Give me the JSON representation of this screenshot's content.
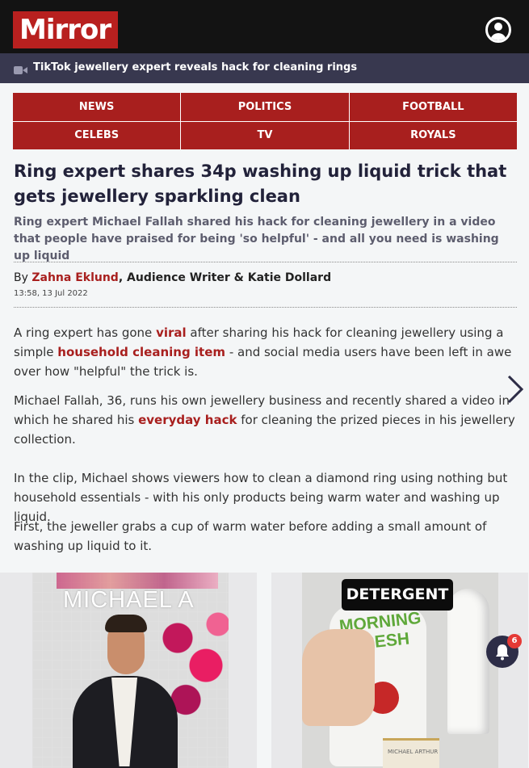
{
  "header": {
    "logo_text": "Mirror",
    "account_icon": "account-icon"
  },
  "video_bar": {
    "icon": "video-camera-icon",
    "title": "TikTok jewellery expert reveals hack for cleaning rings"
  },
  "nav": {
    "items": [
      {
        "label": "NEWS"
      },
      {
        "label": "POLITICS"
      },
      {
        "label": "FOOTBALL"
      },
      {
        "label": "CELEBS"
      },
      {
        "label": "TV"
      },
      {
        "label": "ROYALS"
      }
    ]
  },
  "article": {
    "headline": "Ring expert shares 34p washing up liquid trick that gets jewellery sparkling clean",
    "standfirst": "Ring expert Michael Fallah shared his hack for cleaning jewellery in a video that people have praised for being 'so helpful' - and all you need is washing up liquid",
    "byline": {
      "by": "By",
      "author1": "Zahna Eklund",
      "role": ", Audience Writer & ",
      "author2": " Katie Dollard",
      "timestamp": "13:58, 13 Jul 2022"
    },
    "paragraphs": [
      {
        "t1": "A ring expert has gone ",
        "l1": "viral",
        "t2": " after sharing his hack for cleaning jewellery using a simple ",
        "l2": "household cleaning item",
        "t3": " - and social media users have been left in awe over how \"helpful\" the trick is."
      },
      {
        "t1": "Michael Fallah, 36, runs his own jewellery business and recently shared a video in which he shared his ",
        "l1": "everyday hack",
        "t2": " for cleaning the prized pieces in his jewellery collection."
      },
      {
        "t1": "In the clip, Michael shows viewers how to clean a diamond ring using nothing but household essentials - with his only products being warm water and washing up liquid."
      },
      {
        "t1": "First, the jeweller grabs a cup of warm water before adding a small amount of washing up liquid to it."
      }
    ]
  },
  "images": {
    "photo1_wall_text": "MICHAEL A",
    "photo2_tag": "DETERGENT",
    "photo2_brand_line1": "MORNING",
    "photo2_brand_line2": "FRESH",
    "photo2_box_text": "MICHAEL ARTHUR"
  },
  "notifications": {
    "icon": "bell-icon",
    "count": "6"
  },
  "carousel": {
    "next_icon": "chevron-right-icon"
  },
  "colors": {
    "brand_red": "#a81f1e",
    "header_black": "#131313",
    "video_bar": "#38384f"
  }
}
